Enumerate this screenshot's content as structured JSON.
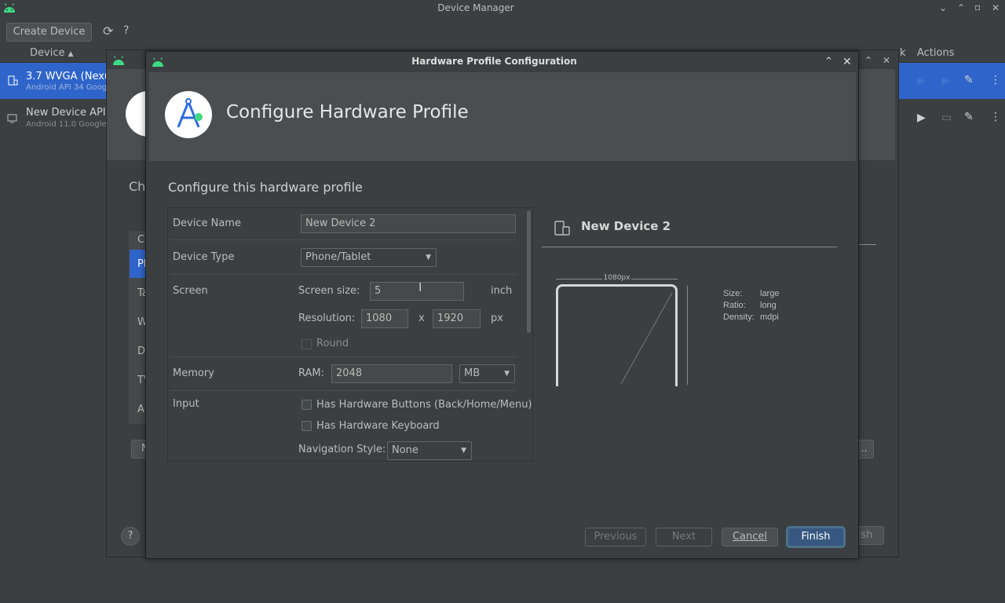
{
  "main_window": {
    "title": "Device Manager",
    "create_device_label": "Create Device",
    "help_label": "?",
    "window_controls": [
      "⌄",
      "⌃",
      "▫",
      "✕"
    ]
  },
  "table": {
    "col_device": "Device",
    "col_k": "k",
    "col_actions": "Actions",
    "rows": [
      {
        "name": "3.7  WVGA (Nexus",
        "sub": "Android API 34 Goog"
      },
      {
        "name": "New Device API 3",
        "sub": "Android 11.0 Google"
      }
    ]
  },
  "bg_wizard": {
    "heading_partial": "Ch",
    "list_header": "Ca",
    "list_items": [
      "Ph",
      "Ta",
      "W",
      "D",
      "TV",
      "Au"
    ],
    "n_button": "N",
    "dots_button": "..",
    "finish_ghost": "sh",
    "help": "?"
  },
  "dialog": {
    "title": "Hardware Profile Configuration",
    "heading": "Configure Hardware Profile",
    "section_title": "Configure this hardware profile",
    "form": {
      "device_name_label": "Device Name",
      "device_name_value": "New Device 2",
      "device_type_label": "Device Type",
      "device_type_value": "Phone/Tablet",
      "screen_label": "Screen",
      "screen_size_label": "Screen size:",
      "screen_size_value": "5",
      "screen_size_unit": "inch",
      "resolution_label": "Resolution:",
      "resolution_w": "1080",
      "resolution_x": "x",
      "resolution_h": "1920",
      "resolution_unit": "px",
      "round_label": "Round",
      "memory_label": "Memory",
      "ram_label": "RAM:",
      "ram_value": "2048",
      "ram_unit": "MB",
      "input_label": "Input",
      "hw_buttons_label": "Has Hardware Buttons (Back/Home/Menu)",
      "hw_keyboard_label": "Has Hardware Keyboard",
      "nav_style_label": "Navigation Style:",
      "nav_style_value": "None"
    },
    "preview": {
      "name": "New Device 2",
      "width_label": "1080px",
      "size_key": "Size:",
      "size_val": "large",
      "ratio_key": "Ratio:",
      "ratio_val": "long",
      "density_key": "Density:",
      "density_val": "mdpi"
    },
    "buttons": {
      "previous": "Previous",
      "next": "Next",
      "cancel": "Cancel",
      "finish": "Finish"
    }
  },
  "colors": {
    "accent": "#2f65ca",
    "android_green": "#3ddc84",
    "default_button": "#365880"
  }
}
